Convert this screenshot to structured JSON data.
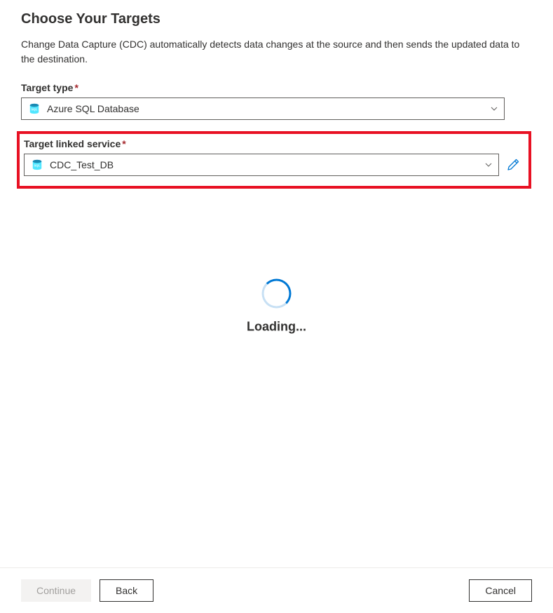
{
  "header": {
    "title": "Choose Your Targets",
    "description": "Change Data Capture (CDC) automatically detects data changes at the source and then sends the updated data to the destination."
  },
  "targetType": {
    "label": "Target type",
    "value": "Azure SQL Database",
    "icon": "azure-sql-icon"
  },
  "targetLinkedService": {
    "label": "Target linked service",
    "value": "CDC_Test_DB",
    "icon": "azure-sql-icon"
  },
  "loading": {
    "text": "Loading..."
  },
  "footer": {
    "continueLabel": "Continue",
    "backLabel": "Back",
    "cancelLabel": "Cancel"
  }
}
